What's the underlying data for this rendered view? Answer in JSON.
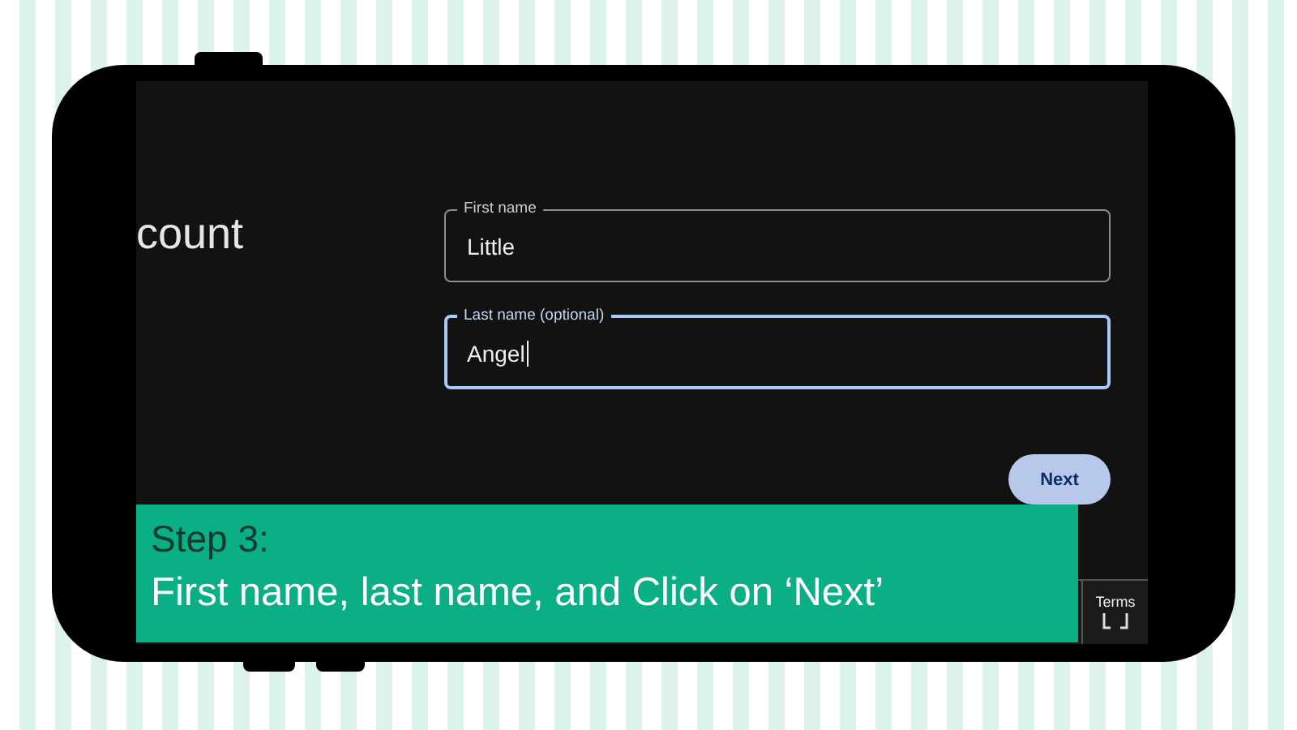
{
  "heading": "count",
  "fields": [
    {
      "label": "First name",
      "value": "Little",
      "focused": false
    },
    {
      "label": "Last name (optional)",
      "value": "Angel",
      "focused": true
    }
  ],
  "next_button": "Next",
  "footer": {
    "link": "Terms"
  },
  "caption": {
    "title": "Step 3:",
    "text": "First name, last name, and Click on ‘Next’"
  }
}
